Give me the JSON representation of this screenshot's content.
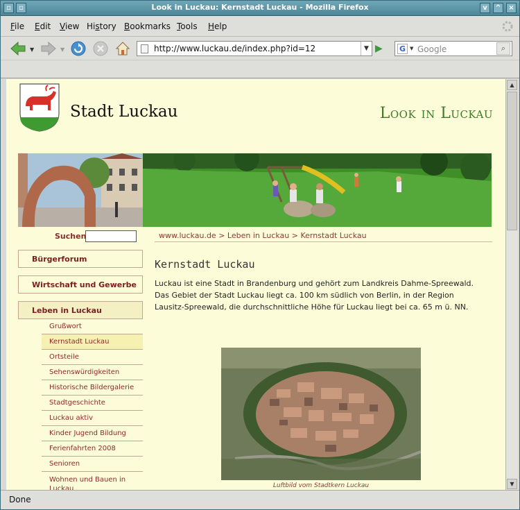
{
  "window": {
    "title": "Look in Luckau: Kernstadt Luckau - Mozilla Firefox"
  },
  "menu": [
    {
      "label": "File",
      "accel": "F",
      "rest": "ile"
    },
    {
      "label": "Edit",
      "accel": "E",
      "rest": "dit"
    },
    {
      "label": "View",
      "accel": "V",
      "rest": "iew"
    },
    {
      "label": "History",
      "accel": "s",
      "pre": "Hi",
      "rest": "tory"
    },
    {
      "label": "Bookmarks",
      "accel": "B",
      "rest": "ookmarks"
    },
    {
      "label": "Tools",
      "accel": "T",
      "rest": "ools"
    },
    {
      "label": "Help",
      "accel": "H",
      "rest": "elp"
    }
  ],
  "navbar": {
    "url": "http://www.luckau.de/index.php?id=12",
    "search_placeholder": "Google"
  },
  "page": {
    "site_title": "Stadt Luckau",
    "tagline": "Look in Luckau",
    "search_label": "Suchen",
    "breadcrumb": [
      "www.luckau.de",
      "Leben in Luckau",
      "Kernstadt Luckau"
    ],
    "breadcrumb_sep": ">",
    "nav_main": [
      {
        "label": "Bürgerforum",
        "active": false
      },
      {
        "label": "Wirtschaft und Gewerbe",
        "active": false
      },
      {
        "label": "Leben in Luckau",
        "active": true
      }
    ],
    "nav_sub": [
      {
        "label": "Grußwort",
        "active": false
      },
      {
        "label": "Kernstadt Luckau",
        "active": true
      },
      {
        "label": "Ortsteile",
        "active": false
      },
      {
        "label": "Sehenswürdigkeiten",
        "active": false
      },
      {
        "label": "Historische Bildergalerie",
        "active": false
      },
      {
        "label": "Stadtgeschichte",
        "active": false
      },
      {
        "label": "Luckau aktiv",
        "active": false
      },
      {
        "label": "Kinder Jugend Bildung",
        "active": false
      },
      {
        "label": "Ferienfahrten 2008",
        "active": false
      },
      {
        "label": "Senioren",
        "active": false
      },
      {
        "label": "Wohnen und Bauen in Luckau",
        "active": false
      }
    ],
    "heading": "Kernstadt Luckau",
    "paragraph_lines": [
      "Luckau ist eine Stadt in Brandenburg und gehört zum Landkreis Dahme-Spreewald.",
      "Das Gebiet der Stadt Luckau liegt ca. 100 km südlich von Berlin, in der Region",
      "Lausitz-Spreewald, die durchschnittliche Höhe für Luckau liegt bei ca. 65 m ü. NN."
    ],
    "photo_caption": "Luftbild vom Stadtkern Luckau"
  },
  "status": {
    "text": "Done"
  },
  "colors": {
    "titlebar": "#5a93a5",
    "page_bg": "#fdfcd8",
    "link": "#8b2a2a",
    "tagline": "#3b7a2a"
  }
}
